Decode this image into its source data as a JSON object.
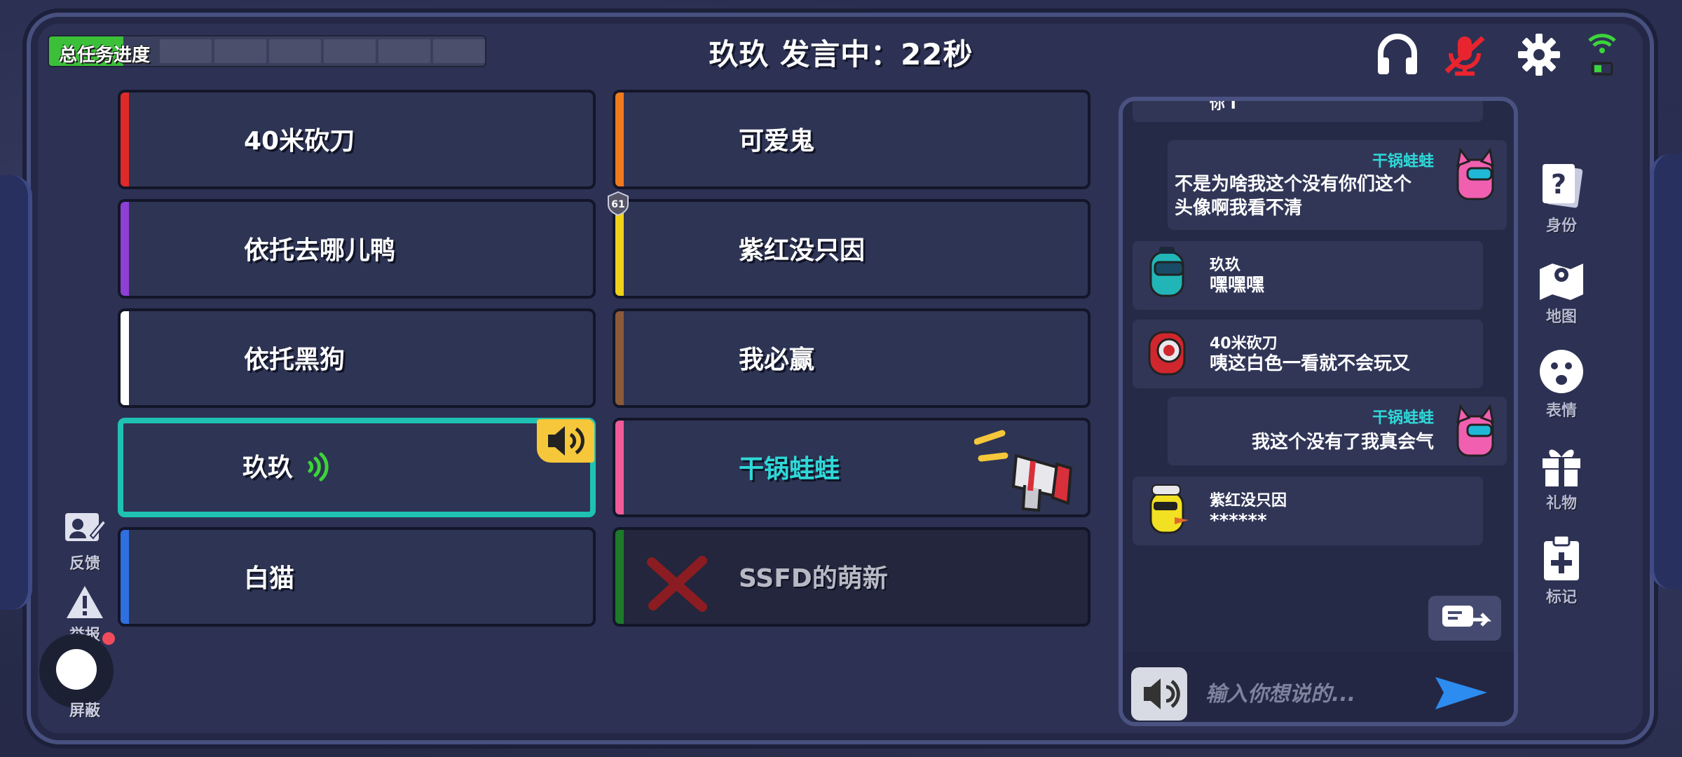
{
  "progress": {
    "label": "总任务进度",
    "fraction": 0.17
  },
  "speaking_title": "玖玖 发言中：22秒",
  "level_badge": "61",
  "players": [
    {
      "name": "40米砍刀",
      "color": "#e02a2a"
    },
    {
      "name": "可爱鬼",
      "color": "#f07a1e"
    },
    {
      "name": "依托去哪儿鸭",
      "color": "#8e3fd6"
    },
    {
      "name": "紫红没只因",
      "color": "#efd21a"
    },
    {
      "name": "依托黑狗",
      "color": "#ffffff"
    },
    {
      "name": "我必赢",
      "color": "#8b5a3a"
    },
    {
      "name": "玖玖",
      "color": "#1fc2b2"
    },
    {
      "name": "干锅蛙蛙",
      "color": "#f25b9a",
      "name_color": "#2fd8d8"
    },
    {
      "name": "白猫",
      "color": "#2f6fe0"
    },
    {
      "name": "SSFD的萌新",
      "color": "#1d7a2a"
    }
  ],
  "left_bar": {
    "feedback": "反馈",
    "report": "举报",
    "mute": "屏蔽"
  },
  "chat": {
    "partial_top": "你 I",
    "messages": [
      {
        "side": "right",
        "name": "干锅蛙蛙",
        "text": "不是为啥我这个没有你们这个头像啊我看不清",
        "text_line1": "不是为啥我这个没有你们这个",
        "text_line2": "头像啊我看不清"
      },
      {
        "side": "left",
        "name": "玖玖",
        "text": "嘿嘿嘿"
      },
      {
        "side": "left",
        "name": "40米砍刀",
        "text": "咦这白色一看就不会玩又"
      },
      {
        "side": "right",
        "name": "干锅蛙蛙",
        "text": "我这个没有了我真会气"
      },
      {
        "side": "left",
        "name": "紫红没只因",
        "text": "******"
      }
    ],
    "input_placeholder": "输入你想说的..."
  },
  "right_menu": {
    "identity": "身份",
    "map": "地图",
    "emote": "表情",
    "gift": "礼物",
    "mark": "标记"
  }
}
